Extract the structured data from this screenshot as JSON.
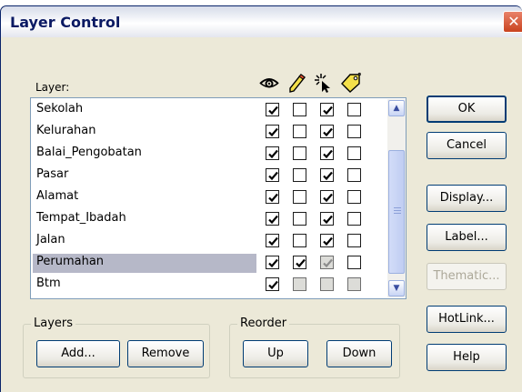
{
  "window": {
    "title": "Layer Control",
    "close_glyph": "✕"
  },
  "list_header": {
    "label": "Layer:",
    "icons": [
      "eye-icon",
      "pencil-icon",
      "cursor-select-icon",
      "label-tag-icon"
    ]
  },
  "layers": [
    {
      "name": "Sekolah",
      "visible": true,
      "editable": false,
      "selectable": true,
      "label": false
    },
    {
      "name": "Kelurahan",
      "visible": true,
      "editable": false,
      "selectable": true,
      "label": false
    },
    {
      "name": "Balai_Pengobatan",
      "visible": true,
      "editable": false,
      "selectable": true,
      "label": false
    },
    {
      "name": "Pasar",
      "visible": true,
      "editable": false,
      "selectable": true,
      "label": false
    },
    {
      "name": "Alamat",
      "visible": true,
      "editable": false,
      "selectable": true,
      "label": false
    },
    {
      "name": "Tempat_Ibadah",
      "visible": true,
      "editable": false,
      "selectable": true,
      "label": false
    },
    {
      "name": "Jalan",
      "visible": true,
      "editable": false,
      "selectable": true,
      "label": false
    },
    {
      "name": "Perumahan",
      "visible": true,
      "editable": true,
      "selectable": true,
      "label": false,
      "selected": true,
      "selectable_disabled": true
    },
    {
      "name": "Btm",
      "visible": true,
      "editable": false,
      "selectable": false,
      "label": false,
      "editable_disabled": true,
      "selectable_disabled": true,
      "label_disabled": true
    }
  ],
  "side_buttons": {
    "ok": "OK",
    "cancel": "Cancel",
    "display": "Display...",
    "label": "Label...",
    "thematic": "Thematic...",
    "hotlink": "HotLink...",
    "help": "Help"
  },
  "layers_group": {
    "legend": "Layers",
    "add": "Add...",
    "remove": "Remove"
  },
  "reorder_group": {
    "legend": "Reorder",
    "up": "Up",
    "down": "Down"
  },
  "colors": {
    "selected_row": "#b6b8c8",
    "dialog_bg": "#ece9d8",
    "button_border": "#003c74"
  }
}
